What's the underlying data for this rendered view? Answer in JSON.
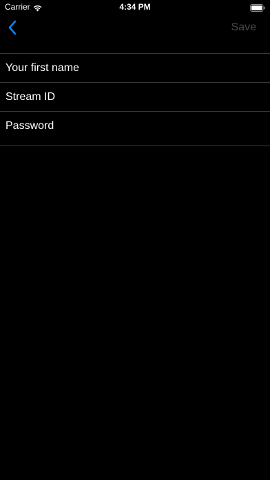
{
  "status_bar": {
    "carrier": "Carrier",
    "time": "4:34 PM",
    "wifi_icon": "wifi-icon",
    "battery_icon": "battery-icon"
  },
  "nav_bar": {
    "back_icon": "chevron-left-icon",
    "save_label": "Save",
    "accent_color": "#0a84ff",
    "save_disabled_color": "#4a4a4e"
  },
  "form": {
    "fields": [
      {
        "placeholder": "Your first name",
        "value": ""
      },
      {
        "placeholder": "Stream ID",
        "value": ""
      },
      {
        "placeholder": "Password",
        "value": ""
      }
    ]
  }
}
